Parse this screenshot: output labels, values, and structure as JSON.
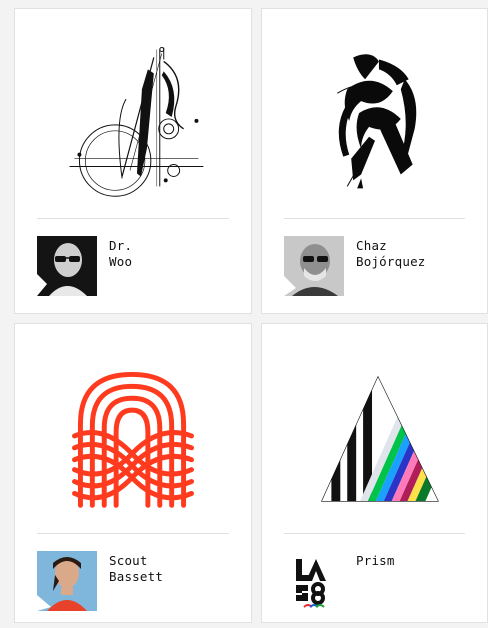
{
  "cards": [
    {
      "name_lines": [
        "Dr.",
        "Woo"
      ],
      "art": "dr-woo-logo",
      "avatar": "dr-woo-photo"
    },
    {
      "name_lines": [
        "Chaz",
        "Bojórquez"
      ],
      "art": "chaz-bojorquez-logo",
      "avatar": "chaz-bojorquez-photo"
    },
    {
      "name_lines": [
        "Scout",
        "Bassett"
      ],
      "art": "scout-bassett-logo",
      "avatar": "scout-bassett-photo"
    },
    {
      "name_lines": [
        "Prism"
      ],
      "art": "prism-logo",
      "avatar": "la28-paralympics-logo"
    }
  ],
  "colors": {
    "background": "#f3f3f3",
    "card": "#ffffff",
    "divider": "#e0e0e0",
    "scout_red": "#ff3b1f"
  }
}
